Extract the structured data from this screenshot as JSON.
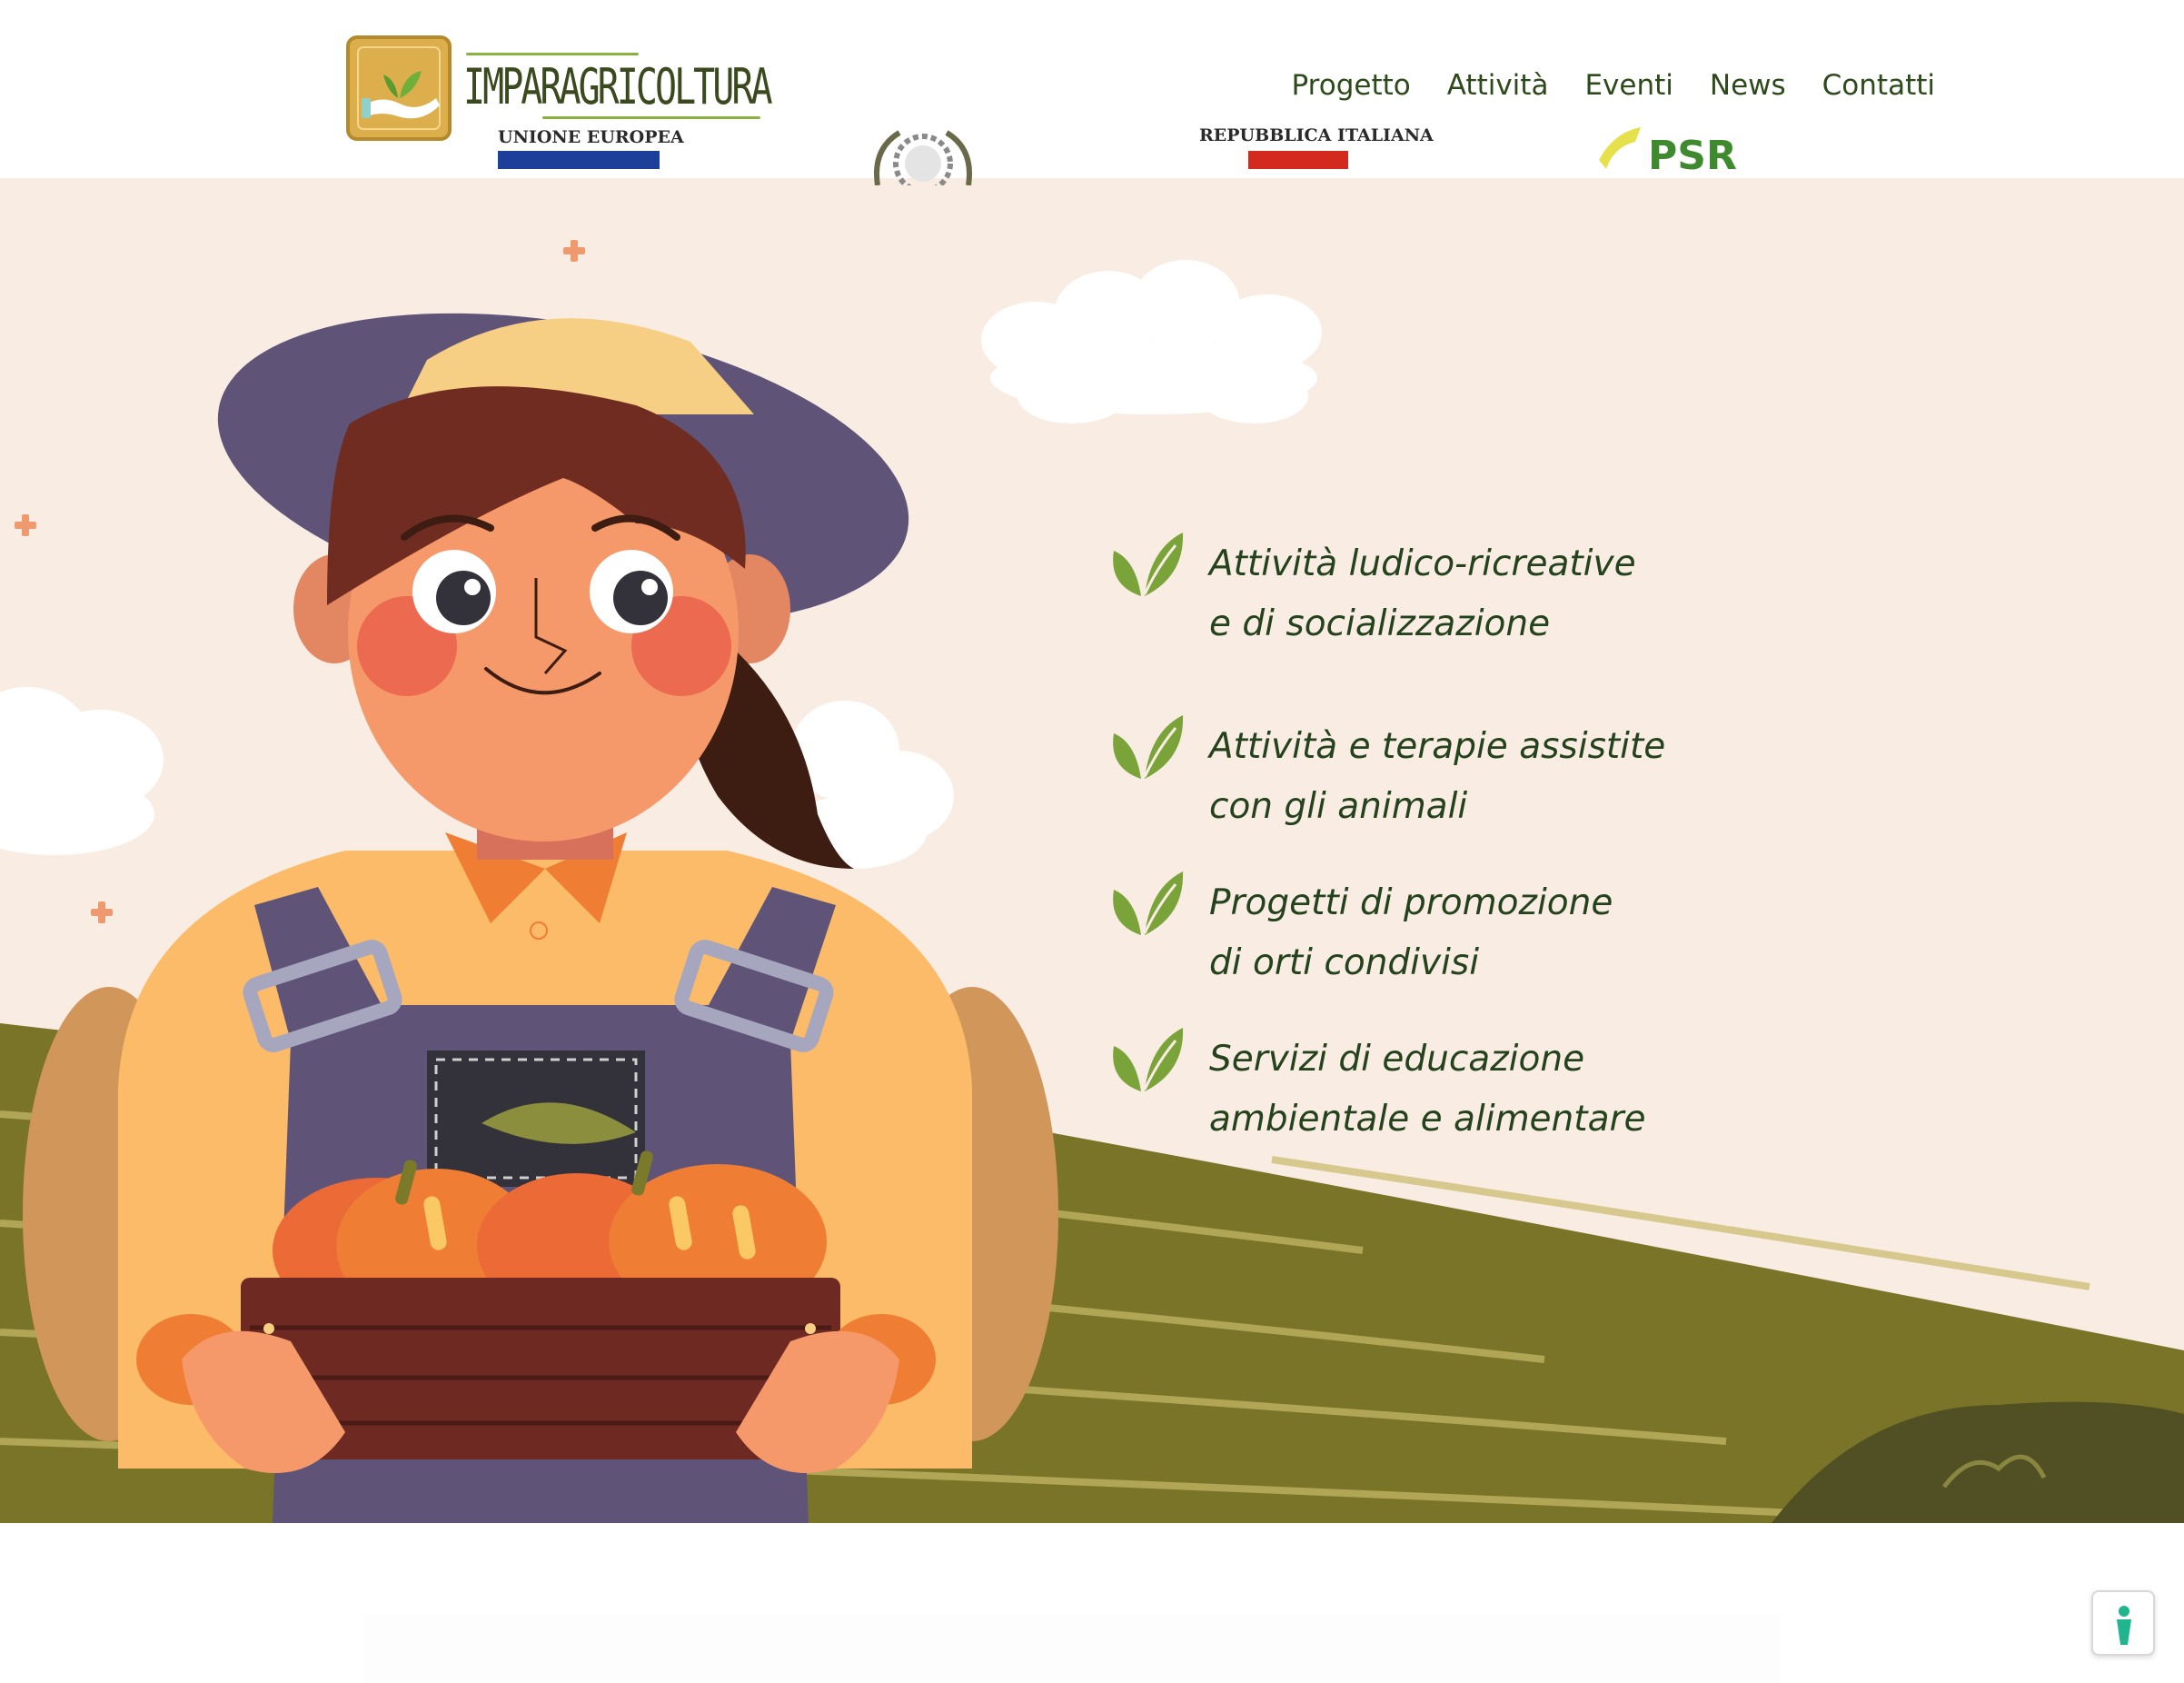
{
  "header": {
    "logo_text": "IMPARAGRICOLTURA",
    "nav": [
      "Progetto",
      "Attività",
      "Eventi",
      "News",
      "Contatti"
    ]
  },
  "hero": {
    "features": [
      {
        "line1": "Attività ludico-ricreative",
        "line2": "e di socializzazione"
      },
      {
        "line1": "Attività e terapie assistite",
        "line2": "con gli animali"
      },
      {
        "line1": "Progetti di promozione",
        "line2": "di orti condivisi"
      },
      {
        "line1": "Servizi di educazione",
        "line2": "ambientale e alimentare"
      }
    ]
  },
  "partners": {
    "eu_label": "UNIONE EUROPEA",
    "ri_label": "REPUBBLICA ITALIANA",
    "psr_label": "PSR"
  },
  "colors": {
    "nav_text": "#2d4a1a",
    "feature_text": "#24421b",
    "leaf_green": "#7aa43a",
    "hero_bg": "#f9ece3",
    "field_green": "#7a7428",
    "logo_gold": "#dcae4c"
  },
  "icons": {
    "feature_bullet": "leaf-icon",
    "accessibility": "accessibility-icon"
  }
}
